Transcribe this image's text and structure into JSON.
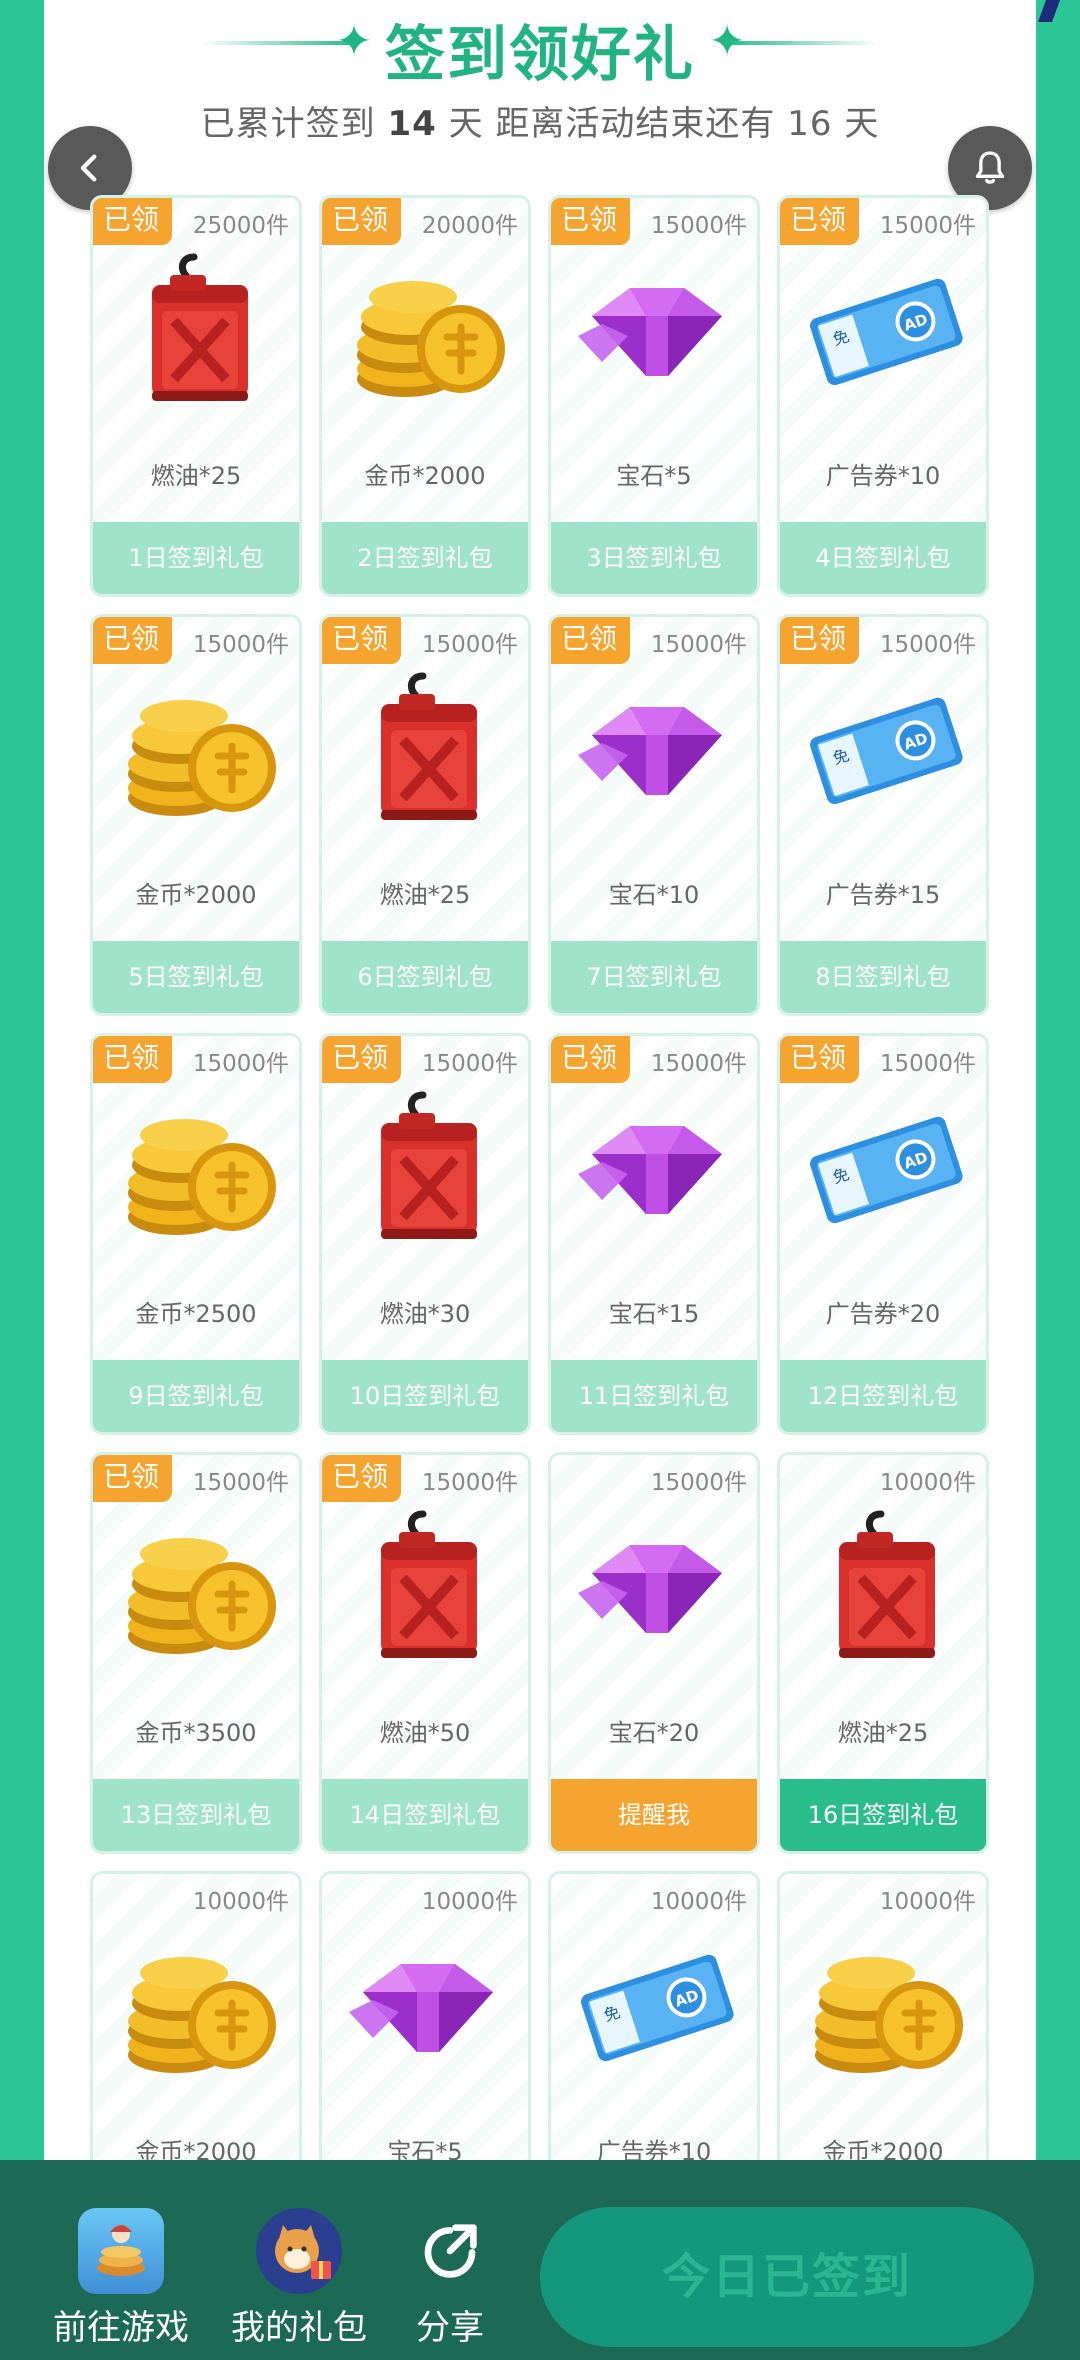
{
  "header": {
    "title": "签到领好礼",
    "subtitle_prefix": "已累计签到",
    "signed_days": "14",
    "subtitle_mid": "天  距离活动结束还有",
    "remaining_days": "16",
    "subtitle_suffix": "天"
  },
  "claimed_label": "已领",
  "cards": [
    {
      "qty": "25000件",
      "item": "fuel",
      "reward": "燃油*25",
      "day": "1日签到礼包",
      "claimed": true,
      "state": "claimed"
    },
    {
      "qty": "20000件",
      "item": "coin",
      "reward": "金币*2000",
      "day": "2日签到礼包",
      "claimed": true,
      "state": "claimed"
    },
    {
      "qty": "15000件",
      "item": "gem",
      "reward": "宝石*5",
      "day": "3日签到礼包",
      "claimed": true,
      "state": "claimed"
    },
    {
      "qty": "15000件",
      "item": "ad",
      "reward": "广告券*10",
      "day": "4日签到礼包",
      "claimed": true,
      "state": "claimed"
    },
    {
      "qty": "15000件",
      "item": "coin",
      "reward": "金币*2000",
      "day": "5日签到礼包",
      "claimed": true,
      "state": "claimed"
    },
    {
      "qty": "15000件",
      "item": "fuel",
      "reward": "燃油*25",
      "day": "6日签到礼包",
      "claimed": true,
      "state": "claimed"
    },
    {
      "qty": "15000件",
      "item": "gem",
      "reward": "宝石*10",
      "day": "7日签到礼包",
      "claimed": true,
      "state": "claimed"
    },
    {
      "qty": "15000件",
      "item": "ad",
      "reward": "广告券*15",
      "day": "8日签到礼包",
      "claimed": true,
      "state": "claimed"
    },
    {
      "qty": "15000件",
      "item": "coin",
      "reward": "金币*2500",
      "day": "9日签到礼包",
      "claimed": true,
      "state": "claimed"
    },
    {
      "qty": "15000件",
      "item": "fuel",
      "reward": "燃油*30",
      "day": "10日签到礼包",
      "claimed": true,
      "state": "claimed"
    },
    {
      "qty": "15000件",
      "item": "gem",
      "reward": "宝石*15",
      "day": "11日签到礼包",
      "claimed": true,
      "state": "claimed"
    },
    {
      "qty": "15000件",
      "item": "ad",
      "reward": "广告券*20",
      "day": "12日签到礼包",
      "claimed": true,
      "state": "claimed"
    },
    {
      "qty": "15000件",
      "item": "coin",
      "reward": "金币*3500",
      "day": "13日签到礼包",
      "claimed": true,
      "state": "claimed"
    },
    {
      "qty": "15000件",
      "item": "fuel",
      "reward": "燃油*50",
      "day": "14日签到礼包",
      "claimed": true,
      "state": "claimed"
    },
    {
      "qty": "15000件",
      "item": "gem",
      "reward": "宝石*20",
      "day": "提醒我",
      "claimed": false,
      "state": "remind"
    },
    {
      "qty": "10000件",
      "item": "fuel",
      "reward": "燃油*25",
      "day": "16日签到礼包",
      "claimed": false,
      "state": "available"
    },
    {
      "qty": "10000件",
      "item": "coin",
      "reward": "金币*2000",
      "day": "",
      "claimed": false,
      "state": "partial"
    },
    {
      "qty": "10000件",
      "item": "gem",
      "reward": "宝石*5",
      "day": "",
      "claimed": false,
      "state": "partial"
    },
    {
      "qty": "10000件",
      "item": "ad",
      "reward": "广告券*10",
      "day": "",
      "claimed": false,
      "state": "partial"
    },
    {
      "qty": "10000件",
      "item": "coin",
      "reward": "金币*2000",
      "day": "",
      "claimed": false,
      "state": "partial"
    }
  ],
  "bottom_bar": {
    "go_game": "前往游戏",
    "my_gifts": "我的礼包",
    "share": "分享",
    "signed_today": "今日已签到"
  },
  "colors": {
    "accent": "#21b482",
    "claimed_badge": "#f5a52f",
    "day_bar_claimed": "#9fe3ca",
    "day_bar_available": "#29bd8c",
    "remind": "#f5a52f",
    "bottom_bar": "#1c6a55"
  },
  "icons": {
    "back": "chevron-left-icon",
    "bell": "bell-icon",
    "share": "share-icon"
  }
}
